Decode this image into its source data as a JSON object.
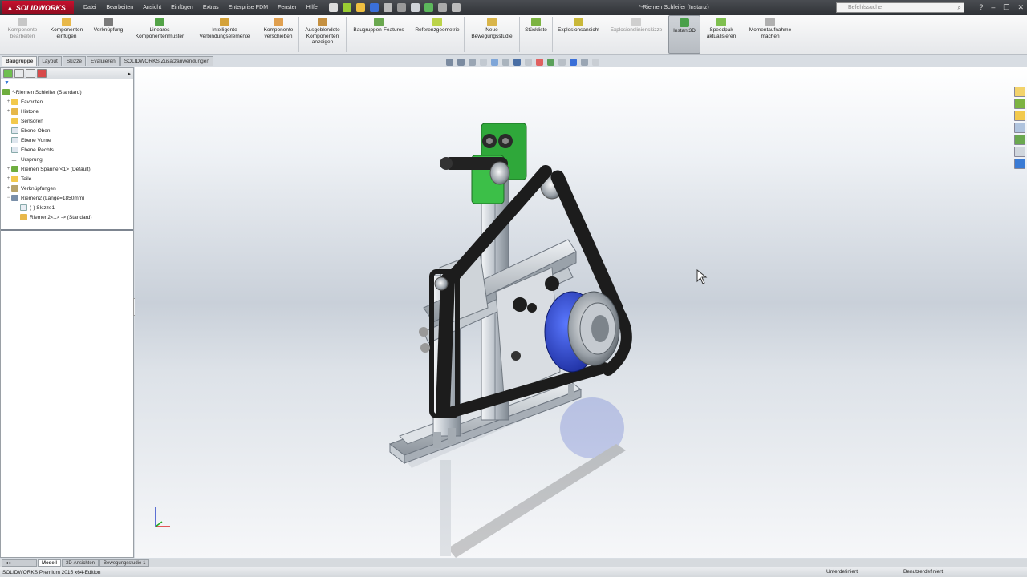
{
  "app": {
    "logo": "SOLIDWORKS",
    "menu": [
      "Datei",
      "Bearbeiten",
      "Ansicht",
      "Einfügen",
      "Extras",
      "Enterprise PDM",
      "Fenster",
      "Hilfe"
    ],
    "doc_title": "*-Riemen Schleifer (Instanz)",
    "search_placeholder": "Befehlssuche"
  },
  "commands": [
    {
      "label": "Komponente bearbeiten",
      "icon": "edit-component-icon",
      "disabled": true
    },
    {
      "label": "Komponenten einfügen",
      "icon": "insert-components-icon"
    },
    {
      "label": "Verknüpfung",
      "icon": "mate-icon"
    },
    {
      "label": "Lineares Komponentenmuster",
      "icon": "linear-pattern-icon"
    },
    {
      "label": "Intelligente Verbindungselemente",
      "icon": "smart-fasteners-icon"
    },
    {
      "label": "Komponente verschieben",
      "icon": "move-component-icon"
    },
    {
      "label": "Ausgeblendete Komponenten anzeigen",
      "icon": "show-hidden-icon"
    },
    {
      "label": "Baugruppen-Features",
      "icon": "assembly-features-icon"
    },
    {
      "label": "Referenzgeometrie",
      "icon": "reference-geometry-icon"
    },
    {
      "label": "Neue Bewegungsstudie",
      "icon": "motion-study-icon"
    },
    {
      "label": "Stückliste",
      "icon": "bom-icon"
    },
    {
      "label": "Explosionsansicht",
      "icon": "exploded-view-icon"
    },
    {
      "label": "Explosionslinienskizze",
      "icon": "explode-line-icon",
      "disabled": true
    },
    {
      "label": "Instant3D",
      "icon": "instant3d-icon",
      "active": true
    },
    {
      "label": "Speedpak aktualisieren",
      "icon": "speedpak-icon"
    },
    {
      "label": "Momentaufnahme machen",
      "icon": "snapshot-icon"
    }
  ],
  "tabs": [
    "Baugruppe",
    "Layout",
    "Skizze",
    "Evaluieren",
    "SOLIDWORKS Zusatzanwendungen"
  ],
  "tree": [
    {
      "label": "*-Riemen Schleifer  (Standard)",
      "indent": 0,
      "icon": "assembly-icon"
    },
    {
      "label": "Favoriten",
      "indent": 1,
      "icon": "folder-icon"
    },
    {
      "label": "Historie",
      "indent": 1,
      "icon": "history-icon"
    },
    {
      "label": "Sensoren",
      "indent": 1,
      "icon": "sensor-icon"
    },
    {
      "label": "Ebene Oben",
      "indent": 1,
      "icon": "plane-icon"
    },
    {
      "label": "Ebene Vorne",
      "indent": 1,
      "icon": "plane-icon"
    },
    {
      "label": "Ebene Rechts",
      "indent": 1,
      "icon": "plane-icon"
    },
    {
      "label": "Ursprung",
      "indent": 1,
      "icon": "origin-icon"
    },
    {
      "label": "Riemen Spanner<1> (Default)",
      "indent": 1,
      "icon": "subassembly-icon"
    },
    {
      "label": "Teile",
      "indent": 1,
      "icon": "folder-icon"
    },
    {
      "label": "Verknüpfungen",
      "indent": 1,
      "icon": "mates-icon"
    },
    {
      "label": "Riemen2 (Länge=1850mm)",
      "indent": 1,
      "icon": "belt-icon"
    },
    {
      "label": "(-) Skizze1",
      "indent": 2,
      "icon": "sketch-icon"
    },
    {
      "label": "Riemen2<1> -> (Standard)",
      "indent": 2,
      "icon": "part-icon"
    }
  ],
  "bottom_tabs": [
    "Modell",
    "3D-Ansichten",
    "Bewegungsstudie 1"
  ],
  "status": {
    "left": "SOLIDWORKS Premium 2015 x64-Edition",
    "mid": "Unterdefiniert",
    "right": "Benutzerdefiniert"
  },
  "colors": {
    "brand": "#c8102e",
    "belt": "#1c1c1c",
    "pulley": "#2244cc",
    "bracket": "#2fa83a"
  }
}
